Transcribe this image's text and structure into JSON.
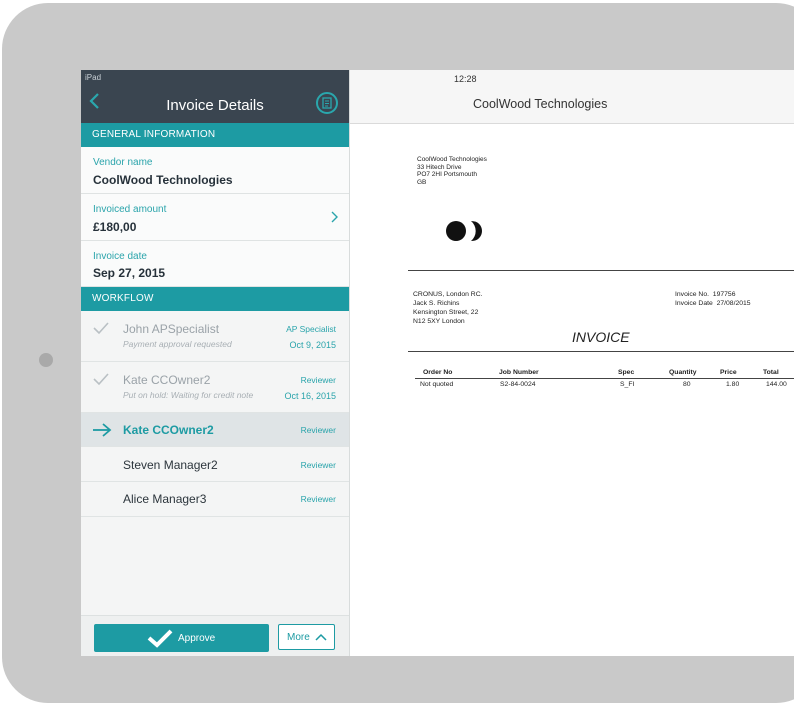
{
  "status_bar": {
    "carrier": "iPad",
    "time": "12:28"
  },
  "left_nav": {
    "title": "Invoice Details"
  },
  "general_info": {
    "section_title": "GENERAL INFORMATION",
    "vendor_label": "Vendor name",
    "vendor_value": "CoolWood Technologies",
    "amount_label": "Invoiced amount",
    "amount_value": "£180,00",
    "date_label": "Invoice date",
    "date_value": "Sep 27, 2015"
  },
  "workflow": {
    "section_title": "WORKFLOW",
    "items": [
      {
        "name": "John APSpecialist",
        "note": "Payment approval requested",
        "role": "AP Specialist",
        "date": "Oct 9, 2015",
        "state": "done"
      },
      {
        "name": "Kate CCOwner2",
        "note": "Put on hold: Waiting for credit note",
        "role": "Reviewer",
        "date": "Oct 16, 2015",
        "state": "done"
      },
      {
        "name": "Kate CCOwner2",
        "note": "",
        "role": "Reviewer",
        "date": "",
        "state": "current"
      },
      {
        "name": "Steven Manager2",
        "note": "",
        "role": "Reviewer",
        "date": "",
        "state": "pending"
      },
      {
        "name": "Alice Manager3",
        "note": "",
        "role": "Reviewer",
        "date": "",
        "state": "pending"
      }
    ]
  },
  "actions": {
    "approve_label": "Approve",
    "more_label": "More"
  },
  "document": {
    "title": "CoolWood Technologies",
    "sender_lines": [
      "CoolWood Technologies",
      "33 Hitech Drive",
      "PO7 2HI Portsmouth",
      "GB"
    ],
    "customer_lines": [
      "CRONUS, London RC.",
      "Jack S. Richins",
      "Kensington Street, 22",
      "N12 5XY London"
    ],
    "invoice_no_label": "Invoice No.",
    "invoice_no": "197756",
    "invoice_date_label": "Invoice Date",
    "invoice_date": "27/08/2015",
    "heading": "INVOICE",
    "table_headers": [
      "Order No",
      "Job Number",
      "Spec",
      "Quantity",
      "Price",
      "Total"
    ],
    "table_row": [
      "Not quoted",
      "S2-84-0024",
      "S_FI",
      "80",
      "1.80",
      "144.00"
    ]
  },
  "colors": {
    "accent": "#1d9ba3",
    "nav_dark": "#3a4550",
    "device": "#c9c9c9"
  }
}
